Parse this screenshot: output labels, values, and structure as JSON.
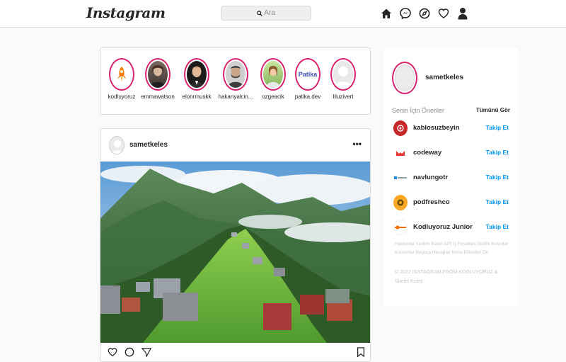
{
  "nav": {
    "logo": "Instagram",
    "search_placeholder": "Ara",
    "icons": [
      "home-icon",
      "messenger-icon",
      "explore-icon",
      "heart-icon",
      "profile-icon"
    ]
  },
  "stories": [
    {
      "name": "kodluyoruz",
      "avatar": "rocket-avatar"
    },
    {
      "name": "emmawatson",
      "avatar": "person-avatar"
    },
    {
      "name": "elonrmuskk",
      "avatar": "person-avatar"
    },
    {
      "name": "hakanyalcin...",
      "avatar": "person-avatar"
    },
    {
      "name": "ozgeacik",
      "avatar": "person-avatar"
    },
    {
      "name": "patika.dev",
      "avatar": "patika-logo",
      "logo_text": "Patika"
    },
    {
      "name": "liluzivert",
      "avatar": "default-avatar"
    }
  ],
  "post": {
    "username": "sametkeles",
    "more": "•••",
    "image": "mountain-village-photo"
  },
  "sidebar": {
    "username": "sametkeles",
    "suggestions_title": "Senin İçin Öneriler",
    "see_all": "Tümünü Gör",
    "suggestions": [
      {
        "name": "kablosuzbeyin",
        "action": "Takip Et",
        "color": "#c62828"
      },
      {
        "name": "codeway",
        "action": "Takip Et",
        "color": "#e53935"
      },
      {
        "name": "navlungotr",
        "action": "Takip Et",
        "color": "#1e88e5"
      },
      {
        "name": "podfreshco",
        "action": "Takip Et",
        "color": "#f9a825"
      },
      {
        "name": "Kodluyoruz Junior",
        "action": "Takip Et",
        "color": "#ef6c00"
      }
    ],
    "footer_links": "Hakkında Yardım Basın API İş Fırsatları Gizlilik Koşullar Konumlar Başlıca Hesaplar Konu Etiketleri Dil",
    "copyright": "© 2022 INSTAGRAM FROM KODLUYORUZ & Samet Keleş"
  }
}
